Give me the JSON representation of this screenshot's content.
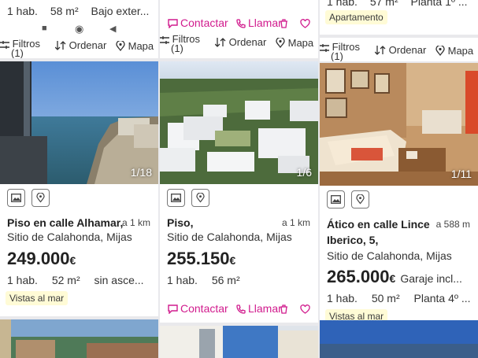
{
  "colors": {
    "accent": "#d11b8d",
    "tag_bg": "#fffbd6"
  },
  "filterbar": {
    "filters": "Filtros",
    "filters_count": "(1)",
    "sort": "Ordenar",
    "map": "Mapa"
  },
  "actions": {
    "contact": "Contactar",
    "call": "Llamar"
  },
  "col1_top": {
    "rooms": "1 hab.",
    "area": "58 m²",
    "floor": "Bajo exter..."
  },
  "col2_top": {},
  "col3_top": {
    "rooms": "1 hab.",
    "area": "57 m²",
    "floor": "Planta 1º ...",
    "tag": "Apartamento"
  },
  "listings": [
    {
      "counter": "1/18",
      "title": "Piso en calle Alhamar,",
      "distance": "a 1 km",
      "location": "Sitio de Calahonda, Mijas",
      "price": "249.000",
      "currency": "€",
      "extra": "",
      "rooms": "1 hab.",
      "area": "52 m²",
      "floor": "sin asce...",
      "tag": "Vistas al mar"
    },
    {
      "counter": "1/6",
      "title": "Piso,",
      "distance": "a 1 km",
      "location": "Sitio de Calahonda, Mijas",
      "price": "255.150",
      "currency": "€",
      "extra": "",
      "rooms": "1 hab.",
      "area": "56 m²",
      "floor": "",
      "tag": ""
    },
    {
      "counter": "1/11",
      "title": "Ático en calle Lince",
      "title2": "Iberico, 5,",
      "distance": "a 588 m",
      "location": "Sitio de Calahonda, Mijas",
      "price": "265.000",
      "currency": "€",
      "extra": "Garaje incl...",
      "rooms": "1 hab.",
      "area": "50 m²",
      "floor": "Planta 4º ...",
      "tag": "Vistas al mar"
    }
  ]
}
